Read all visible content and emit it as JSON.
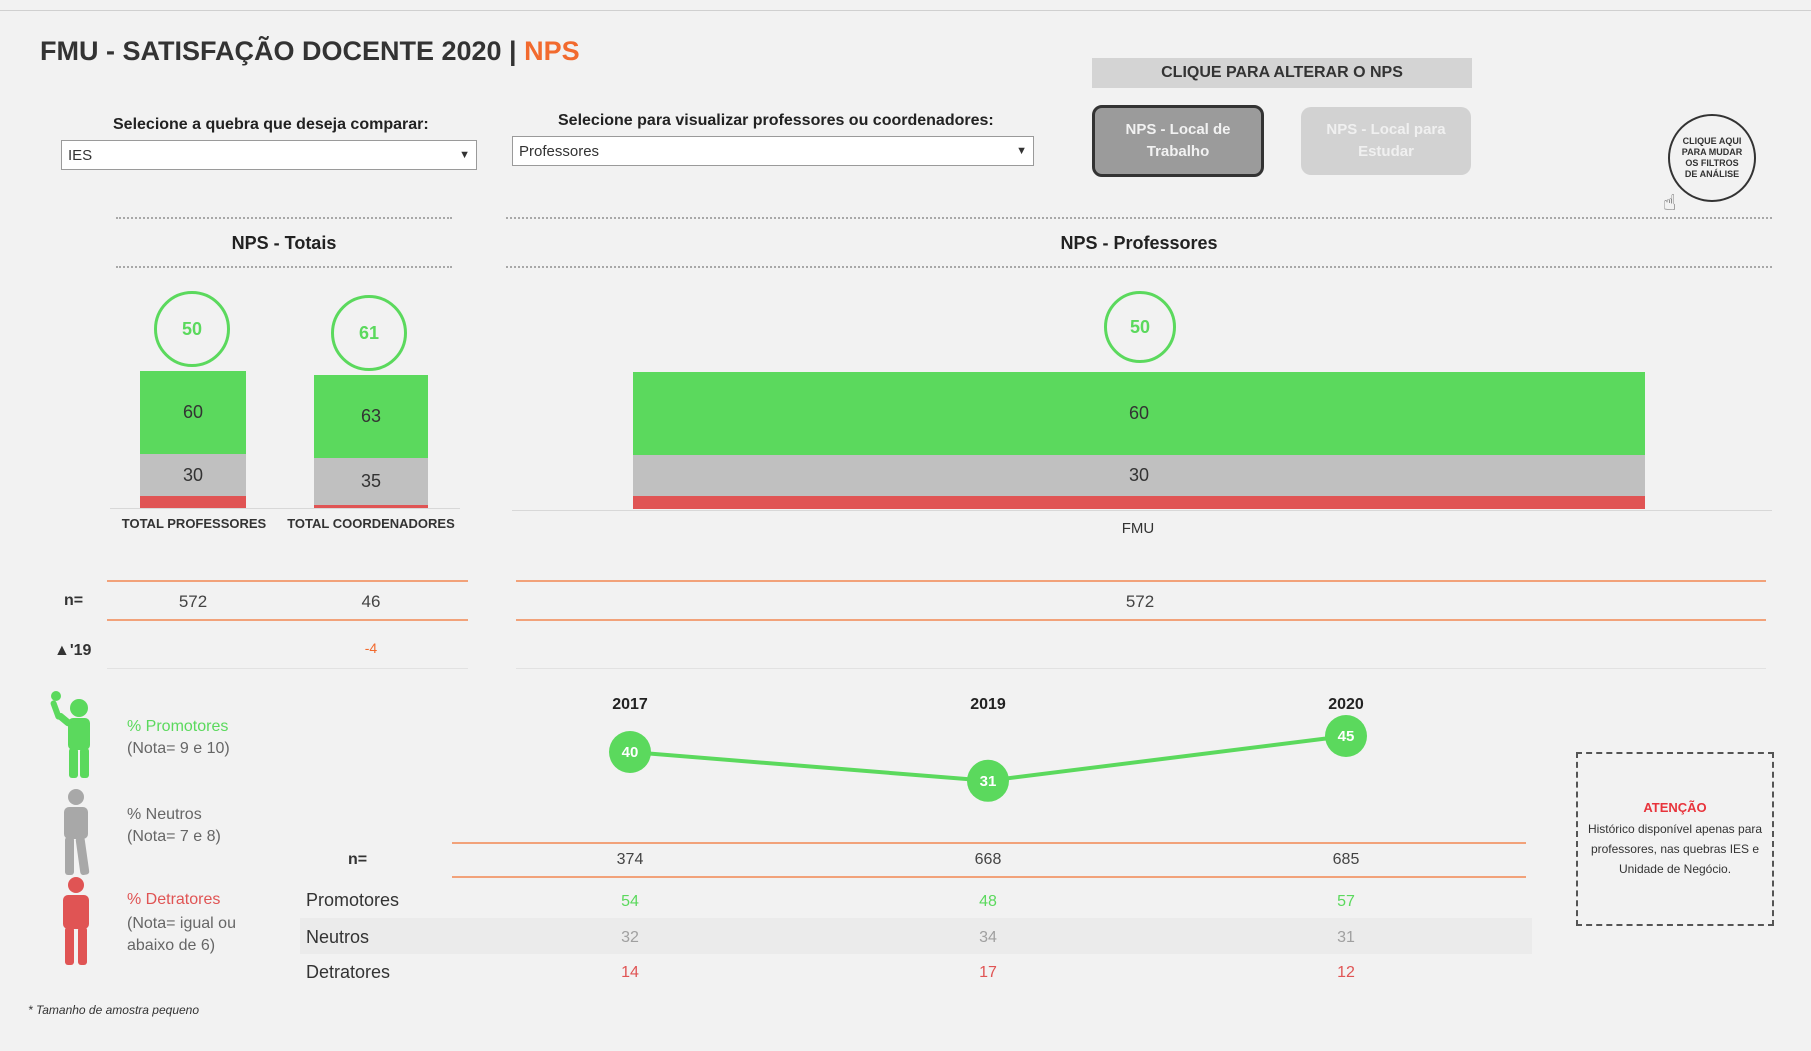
{
  "title": {
    "main": "FMU - SATISFAÇÃO DOCENTE 2020 | ",
    "accent": "NPS"
  },
  "filters": {
    "quebra_label": "Selecione a quebra que deseja comparar:",
    "quebra_value": "IES",
    "visualizar_label": "Selecione para visualizar professores ou coordenadores:",
    "visualizar_value": "Professores"
  },
  "nps_toggle": {
    "header": "CLIQUE PARA ALTERAR O NPS",
    "option_active": "NPS - Local de Trabalho",
    "option_inactive": "NPS - Local para Estudar"
  },
  "round_button": "CLIQUE AQUI PARA MUDAR OS FILTROS DE ANÁLISE",
  "sections": {
    "totais": "NPS - Totais",
    "professores": "NPS - Professores"
  },
  "colors": {
    "promotores": "#5bd95d",
    "neutros": "#c0c0c0",
    "detratores": "#e05454",
    "accent": "#f26a2e"
  },
  "chart_data": [
    {
      "type": "bar",
      "stacked": true,
      "title": "NPS - Totais",
      "categories": [
        "TOTAL PROFESSORES",
        "TOTAL COORDENADORES"
      ],
      "nps": [
        50,
        61
      ],
      "series": [
        {
          "name": "% Promotores",
          "values": [
            60,
            63
          ]
        },
        {
          "name": "% Neutros",
          "values": [
            30,
            35
          ]
        },
        {
          "name": "% Detratores",
          "values": [
            10,
            2
          ]
        }
      ],
      "n": [
        "572",
        "46"
      ],
      "delta_19": [
        "",
        "-4"
      ]
    },
    {
      "type": "bar",
      "stacked": true,
      "title": "NPS - Professores",
      "categories": [
        "FMU"
      ],
      "nps": [
        50
      ],
      "series": [
        {
          "name": "% Promotores",
          "values": [
            60
          ]
        },
        {
          "name": "% Neutros",
          "values": [
            30
          ]
        },
        {
          "name": "% Detratores",
          "values": [
            10
          ]
        }
      ],
      "n": [
        "572"
      ]
    },
    {
      "type": "line",
      "x": [
        "2017",
        "2019",
        "2020"
      ],
      "series": [
        {
          "name": "NPS",
          "values": [
            40,
            31,
            45
          ]
        }
      ],
      "ylim": [
        25,
        50
      ],
      "table": {
        "n": [
          "374",
          "668",
          "685"
        ],
        "promotores": [
          "54",
          "48",
          "57"
        ],
        "neutros": [
          "32",
          "34",
          "31"
        ],
        "detratores": [
          "14",
          "17",
          "12"
        ]
      }
    }
  ],
  "row_labels": {
    "n": "n=",
    "delta": "▲'19",
    "promotores": "Promotores",
    "neutros": "Neutros",
    "detratores": "Detratores"
  },
  "legend": {
    "promotores": {
      "label": "% Promotores",
      "sub": "(Nota= 9 e 10)"
    },
    "neutros": {
      "label": "% Neutros",
      "sub": "(Nota= 7 e 8)"
    },
    "detratores": {
      "label": "% Detratores",
      "sub": "(Nota= igual ou abaixo de 6)"
    }
  },
  "attention": {
    "title": "ATENÇÃO",
    "body": "Histórico disponível apenas para professores, nas quebras IES e Unidade de Negócio."
  },
  "footnote": "* Tamanho de amostra pequeno"
}
